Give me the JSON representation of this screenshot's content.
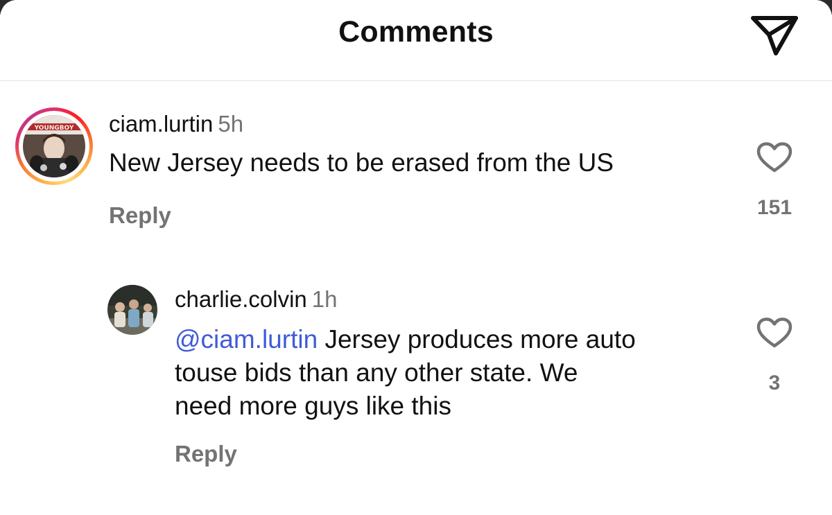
{
  "header": {
    "title": "Comments",
    "share_icon": "paper-plane-icon"
  },
  "comments": [
    {
      "username": "ciam.lurtin",
      "time": "5h",
      "text": "New Jersey needs to be erased from the US",
      "reply_label": "Reply",
      "like_count": "151",
      "avatar_has_story_ring": true,
      "avatar_banner_text": "YOUNGBOY"
    },
    {
      "username": "charlie.colvin",
      "time": "1h",
      "mention": "@ciam.lurtin",
      "text_line1": "Jersey produces more auto",
      "text_line2": "touse bids than any other state. We",
      "text_line3": "need more guys like this",
      "reply_label": "Reply",
      "like_count": "3",
      "avatar_has_story_ring": false
    }
  ],
  "colors": {
    "mention": "#3f5bd6",
    "secondary_text": "#737373",
    "primary_text": "#111111"
  }
}
